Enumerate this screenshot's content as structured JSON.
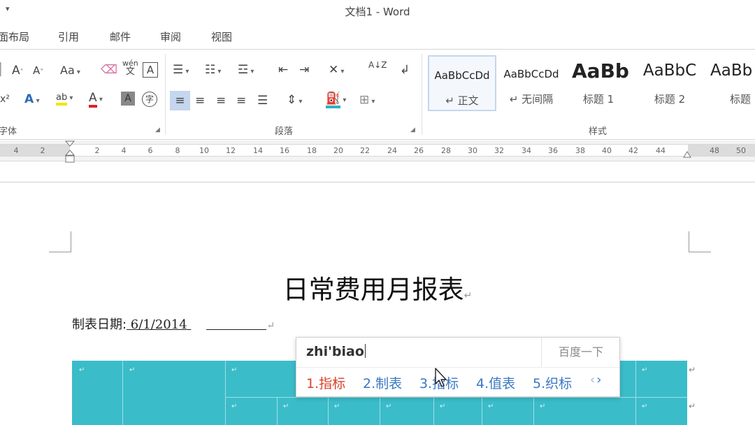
{
  "titlebar": {
    "qat_arrow": "▾",
    "title": "文档1 - Word"
  },
  "tabs": [
    "面布局",
    "引用",
    "邮件",
    "审阅",
    "视图"
  ],
  "ribbon": {
    "groups": {
      "font": "字体",
      "paragraph": "段落",
      "styles": "样式"
    },
    "font_buttons": {
      "grow": "A",
      "shrink": "A",
      "case": "Aa",
      "phonetic_top": "wén",
      "phonetic_bottom": "文",
      "border_char": "A",
      "effects": "A",
      "highlight": "ab",
      "color": "A",
      "shading": "A",
      "enclose": "字",
      "superscript": "x²"
    },
    "sort": "A↓Z"
  },
  "styles_gallery": [
    {
      "preview": "AaBbCcDd",
      "name": "↵ 正文",
      "selected": true
    },
    {
      "preview": "AaBbCcDd",
      "name": "↵ 无间隔",
      "selected": false
    },
    {
      "preview": "AaBb",
      "name": "标题 1",
      "selected": false
    },
    {
      "preview": "AaBbC",
      "name": "标题 2",
      "selected": false
    },
    {
      "preview": "AaBb",
      "name": "标题",
      "selected": false
    }
  ],
  "ruler": {
    "ticks": [
      "4",
      "2",
      "2",
      "4",
      "6",
      "8",
      "10",
      "12",
      "14",
      "16",
      "18",
      "20",
      "22",
      "24",
      "26",
      "28",
      "30",
      "32",
      "34",
      "36",
      "38",
      "40",
      "42",
      "44",
      "48",
      "50"
    ]
  },
  "document": {
    "heading": "日常费用月报表",
    "paragraph_mark": "↵",
    "date_label": "制表日期:",
    "date_value": " 6/1/2014 "
  },
  "ime": {
    "input": "zhi'biao",
    "search_label": "百度一下",
    "candidates": [
      "1.指标",
      "2.制表",
      "3.指标",
      "4.值表",
      "5.织标"
    ],
    "nav_prev": "‹",
    "nav_next": "›"
  },
  "colors": {
    "table_fill": "#3bbcc9",
    "ime_first": "#d9412b",
    "ime_candidate": "#3a78c3"
  }
}
